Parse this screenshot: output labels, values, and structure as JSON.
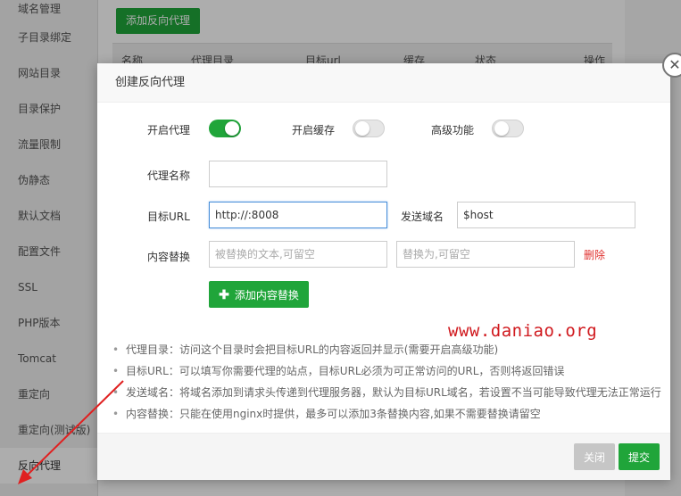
{
  "sidebar": {
    "items": [
      {
        "label": "域名管理"
      },
      {
        "label": "子目录绑定"
      },
      {
        "label": "网站目录"
      },
      {
        "label": "目录保护"
      },
      {
        "label": "流量限制"
      },
      {
        "label": "伪静态"
      },
      {
        "label": "默认文档"
      },
      {
        "label": "配置文件"
      },
      {
        "label": "SSL"
      },
      {
        "label": "PHP版本"
      },
      {
        "label": "Tomcat"
      },
      {
        "label": "重定向"
      },
      {
        "label": "重定向(测试版)"
      },
      {
        "label": "反向代理"
      }
    ],
    "active": "反向代理"
  },
  "background": {
    "add_button": "添加反向代理",
    "columns": [
      "名称",
      "代理目录",
      "目标url",
      "缓存",
      "状态",
      "操作"
    ]
  },
  "modal": {
    "title": "创建反向代理",
    "switches": {
      "enable_proxy": {
        "label": "开启代理",
        "on": true
      },
      "enable_cache": {
        "label": "开启缓存",
        "on": false
      },
      "advanced": {
        "label": "高级功能",
        "on": false
      }
    },
    "proxy_name": {
      "label": "代理名称",
      "value": ""
    },
    "target_url": {
      "label": "目标URL",
      "value": "http://:8008"
    },
    "send_domain": {
      "label": "发送域名",
      "value": "$host"
    },
    "content_replace": {
      "label": "内容替换",
      "from_placeholder": "被替换的文本,可留空",
      "to_placeholder": "替换为,可留空",
      "delete_label": "删除"
    },
    "add_replace_button": "添加内容替换",
    "notes": [
      "代理目录：访问这个目录时会把目标URL的内容返回并显示(需要开启高级功能)",
      "目标URL：可以填写你需要代理的站点，目标URL必须为可正常访问的URL，否则将返回错误",
      "发送域名：将域名添加到请求头传递到代理服务器，默认为目标URL域名，若设置不当可能导致代理无法正常运行",
      "内容替换：只能在使用nginx时提供，最多可以添加3条替换内容,如果不需要替换请留空"
    ],
    "close_button": "关闭",
    "submit_button": "提交"
  },
  "watermark": "www.daniao.org",
  "colors": {
    "accent_green": "#20a53a",
    "delete_red": "#e0312f",
    "arrow_red": "#e02020"
  }
}
